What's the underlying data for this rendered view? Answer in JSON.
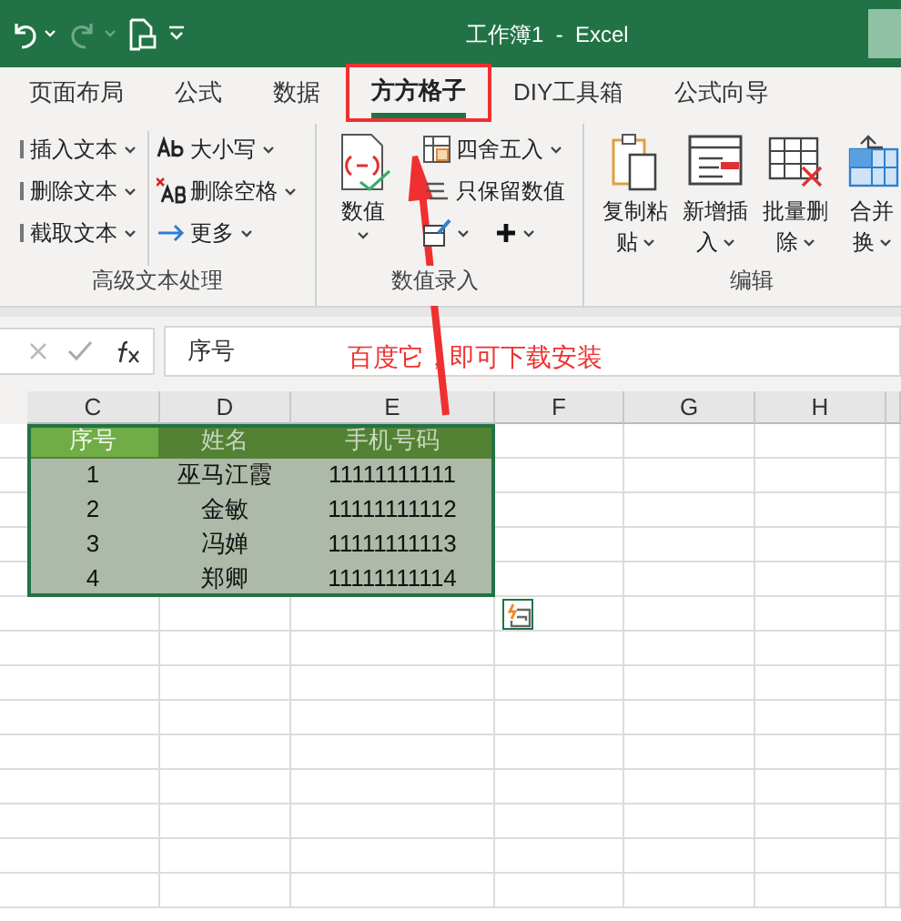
{
  "window": {
    "title": "工作簿1  -  Excel"
  },
  "tabs": [
    {
      "label": "页面布局",
      "selected": false
    },
    {
      "label": "公式",
      "selected": false
    },
    {
      "label": "数据",
      "selected": false
    },
    {
      "label": "方方格子",
      "selected": true
    },
    {
      "label": "DIY工具箱",
      "selected": false
    },
    {
      "label": "公式向导",
      "selected": false
    }
  ],
  "ribbon_groups": [
    {
      "label": "高级文本处理",
      "columns": [
        [
          {
            "kind": "small",
            "label": "插入文本",
            "dropdown": true
          },
          {
            "kind": "small",
            "label": "删除文本",
            "dropdown": true
          },
          {
            "kind": "small",
            "label": "截取文本",
            "dropdown": true
          }
        ],
        [
          {
            "kind": "small",
            "label": "大小写",
            "dropdown": true
          },
          {
            "kind": "small",
            "label": "删除空格",
            "dropdown": true
          },
          {
            "kind": "small",
            "label": "更多",
            "dropdown": true
          }
        ]
      ]
    },
    {
      "label": "数值录入",
      "columns": [
        [
          {
            "kind": "large",
            "lines": [
              "数值"
            ],
            "dropdown": true
          }
        ],
        [
          {
            "kind": "small",
            "label": "四舍五入",
            "dropdown": true
          },
          {
            "kind": "small",
            "label": "只保留数值",
            "dropdown": false
          },
          {
            "kind": "icons",
            "dropdown": true
          }
        ]
      ]
    },
    {
      "label": "编辑",
      "columns": [
        [
          {
            "kind": "large",
            "lines": [
              "复制粘",
              "贴"
            ],
            "dropdown": true
          }
        ],
        [
          {
            "kind": "large",
            "lines": [
              "新增插",
              "入"
            ],
            "dropdown": true
          }
        ],
        [
          {
            "kind": "large",
            "lines": [
              "批量删",
              "除"
            ],
            "dropdown": true
          }
        ],
        [
          {
            "kind": "large",
            "lines": [
              "合并",
              "换"
            ],
            "dropdown": true
          }
        ]
      ]
    }
  ],
  "formula_bar": {
    "value": "序号"
  },
  "annotation": {
    "text": "百度它，即可下载安装"
  },
  "sheet": {
    "columns": [
      "C",
      "D",
      "E",
      "F",
      "G",
      "H"
    ],
    "header": [
      {
        "text": "序号",
        "active": true
      },
      {
        "text": "姓名",
        "active": false
      },
      {
        "text": "手机号码",
        "active": false
      }
    ],
    "rows": [
      [
        "1",
        "巫马江霞",
        "11111111111"
      ],
      [
        "2",
        "金敏",
        "11111111112"
      ],
      [
        "3",
        "冯婵",
        "11111111113"
      ],
      [
        "4",
        "郑卿",
        "11111111114"
      ]
    ]
  }
}
